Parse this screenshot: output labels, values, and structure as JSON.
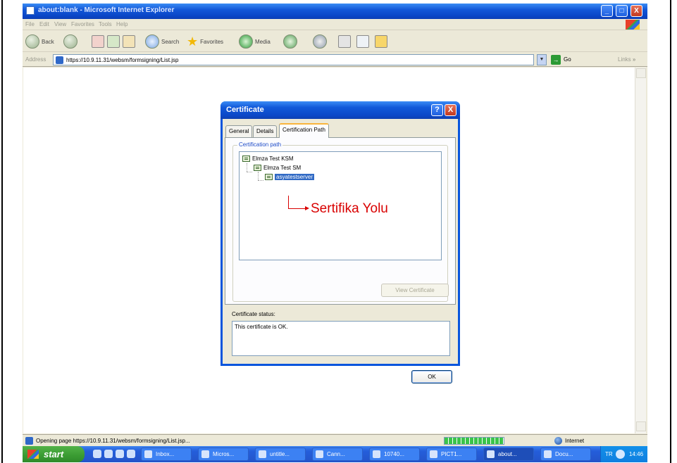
{
  "browser": {
    "title": "about:blank - Microsoft Internet Explorer",
    "window_controls": {
      "minimize": "_",
      "maximize": "□",
      "close": "X"
    },
    "menu": [
      "File",
      "Edit",
      "View",
      "Favorites",
      "Tools",
      "Help"
    ],
    "toolbar": {
      "back_label": "Back",
      "search_label": "Search",
      "favorites_label": "Favorites",
      "media_label": "Media"
    },
    "address": {
      "label": "Address",
      "url": "https://10.9.11.31/websm/formsigning/List.jsp",
      "go_label": "Go",
      "links_label": "Links",
      "links_chevron": "»",
      "dropdown_glyph": "▼",
      "go_glyph": "→"
    },
    "status": {
      "text": "Opening page https://10.9.11.31/websm/formsigning/List.jsp...",
      "progress_percent": 100,
      "zone": "Internet"
    }
  },
  "dialog": {
    "title": "Certificate",
    "help_glyph": "?",
    "close_glyph": "X",
    "tabs": [
      "General",
      "Details",
      "Certification Path"
    ],
    "active_tab": "Certification Path",
    "group_label": "Certification path",
    "tree": [
      {
        "label": "Elmza Test KSM",
        "level": 0,
        "selected": false
      },
      {
        "label": "Elmza Test SM",
        "level": 1,
        "selected": false
      },
      {
        "label": "asyatestserver",
        "level": 2,
        "selected": true
      }
    ],
    "view_certificate_label": "View Certificate",
    "status_label": "Certificate status:",
    "status_text": "This certificate is OK.",
    "ok_label": "OK"
  },
  "annotation": {
    "text": "Sertifika Yolu",
    "color": "#d90000"
  },
  "taskbar": {
    "start_label": "start",
    "buttons": [
      {
        "label": "Inbox...",
        "active": false
      },
      {
        "label": "Micros...",
        "active": false
      },
      {
        "label": "untitle...",
        "active": false
      },
      {
        "label": "Cann...",
        "active": false
      },
      {
        "label": "10740...",
        "active": false
      },
      {
        "label": "PICT1...",
        "active": false
      },
      {
        "label": "about...",
        "active": true
      },
      {
        "label": "Docu...",
        "active": false
      }
    ],
    "tray": {
      "language": "TR",
      "clock": "14:46"
    }
  },
  "colors": {
    "xp_title_blue": "#0a46c7",
    "selection_blue": "#316ac5",
    "taskbar_blue": "#245edb",
    "start_green": "#3a9b32",
    "annotation_red": "#d90000"
  }
}
